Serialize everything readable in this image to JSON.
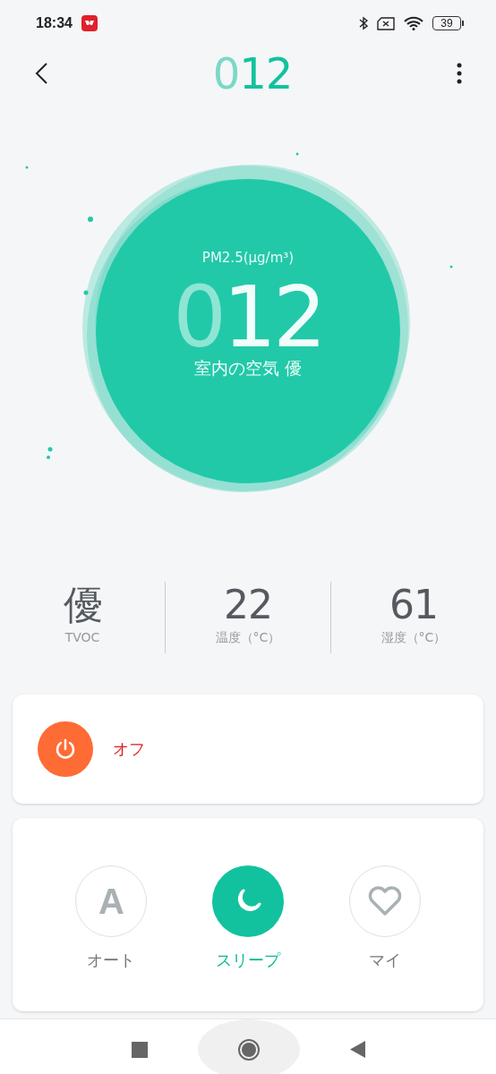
{
  "status_bar": {
    "time": "18:34",
    "battery": "39"
  },
  "header": {
    "title": "012",
    "dim_leading_zero": true
  },
  "gauge": {
    "unit": "PM2.5(μg/m³)",
    "value": "012",
    "dim_leading_zero": true,
    "caption": "室内の空気 優"
  },
  "stats": [
    {
      "value": "優",
      "label": "TVOC"
    },
    {
      "value": "22",
      "label": "温度（°C）"
    },
    {
      "value": "61",
      "label": "湿度（°C）"
    }
  ],
  "power": {
    "on": false,
    "label": "オフ"
  },
  "modes": [
    {
      "kind": "letter",
      "glyph": "A",
      "label": "オート",
      "selected": false
    },
    {
      "kind": "moon",
      "label": "スリープ",
      "selected": true
    },
    {
      "kind": "heart",
      "label": "マイ",
      "selected": false
    }
  ]
}
